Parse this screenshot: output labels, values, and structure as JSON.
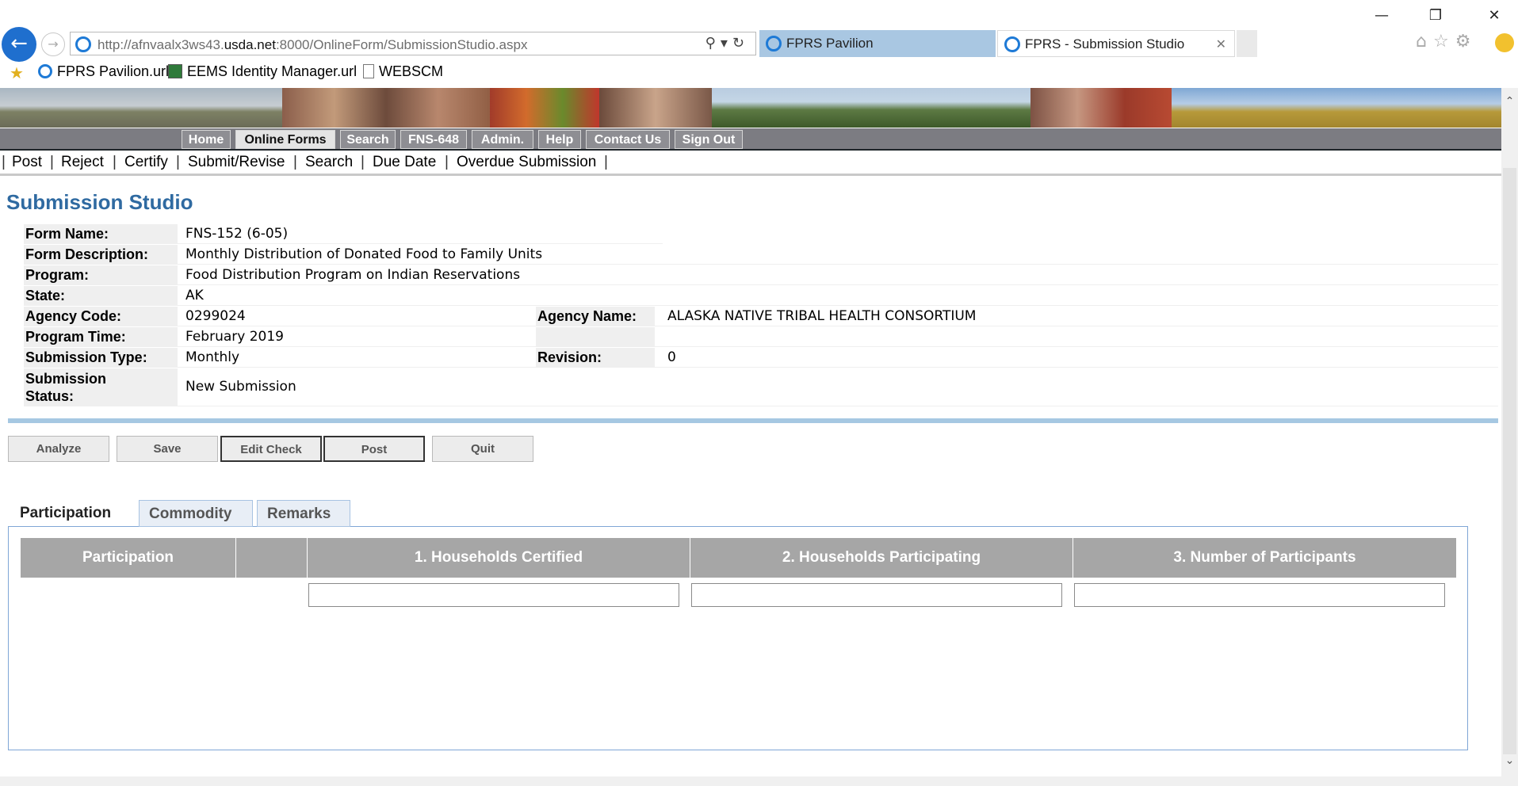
{
  "browser": {
    "address_url_prefix": "http://afnvaalx3ws43.",
    "address_url_domain": "usda.net",
    "address_url_suffix": ":8000/OnlineForm/SubmissionStudio.aspx",
    "tabs": [
      {
        "title": "FPRS Pavilion"
      },
      {
        "title": "FPRS - Submission Studio"
      }
    ],
    "favorites": [
      "FPRS Pavilion.url",
      "EEMS Identity Manager.url",
      "WEBSCM"
    ]
  },
  "nav": {
    "items": [
      "Home",
      "Online Forms",
      "Search",
      "FNS-648",
      "Admin.",
      "Help",
      "Contact Us",
      "Sign Out"
    ],
    "active": "Online Forms"
  },
  "subnav": {
    "items": [
      "Post",
      "Reject",
      "Certify",
      "Submit/Revise",
      "Search",
      "Due Date",
      "Overdue Submission"
    ]
  },
  "page": {
    "title": "Submission Studio"
  },
  "form_info": {
    "form_name_label": "Form Name:",
    "form_name": "FNS-152 (6-05)",
    "form_description_label": "Form Description:",
    "form_description": "Monthly Distribution of Donated Food to Family Units",
    "program_label": "Program:",
    "program": "Food Distribution Program on Indian Reservations",
    "state_label": "State:",
    "state": "AK",
    "agency_code_label": "Agency Code:",
    "agency_code": "0299024",
    "agency_name_label": "Agency Name:",
    "agency_name": "ALASKA NATIVE TRIBAL HEALTH CONSORTIUM",
    "program_time_label": "Program Time:",
    "program_time": "February 2019",
    "submission_type_label": "Submission Type:",
    "submission_type": "Monthly",
    "revision_label": "Revision:",
    "revision": "0",
    "submission_status_label_1": "Submission",
    "submission_status_label_2": "Status:",
    "submission_status": "New Submission"
  },
  "actions": {
    "analyze": "Analyze",
    "save": "Save",
    "edit_check": "Edit Check",
    "post": "Post",
    "quit": "Quit"
  },
  "tabs": [
    "Participation",
    "Commodity",
    "Remarks"
  ],
  "participation_table": {
    "headers": [
      "Participation",
      "",
      "1. Households Certified",
      "2. Households Participating",
      "3. Number of Participants"
    ],
    "inputs": [
      "",
      "",
      ""
    ]
  },
  "colors": {
    "title_blue": "#2f6aa1",
    "nav_gray": "#7c7c82",
    "table_header": "#a6a6a6",
    "divider_blue": "#a6c8e2"
  }
}
